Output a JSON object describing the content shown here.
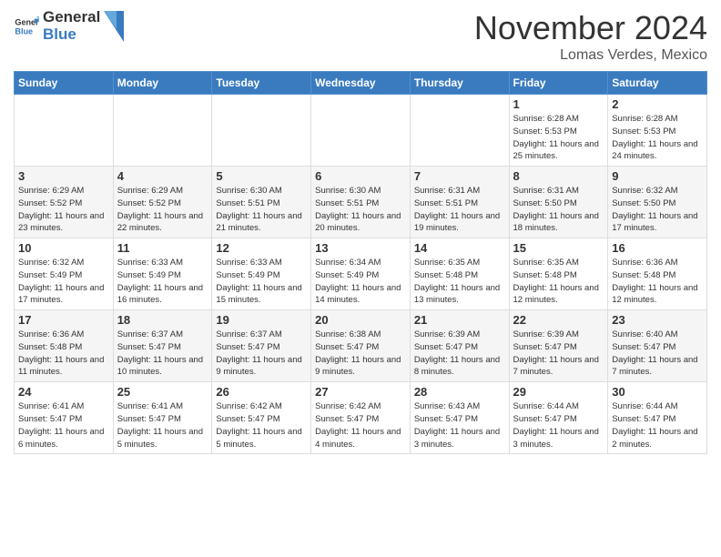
{
  "header": {
    "logo_general": "General",
    "logo_blue": "Blue",
    "month_title": "November 2024",
    "location": "Lomas Verdes, Mexico"
  },
  "weekdays": [
    "Sunday",
    "Monday",
    "Tuesday",
    "Wednesday",
    "Thursday",
    "Friday",
    "Saturday"
  ],
  "weeks": [
    [
      {
        "day": "",
        "detail": ""
      },
      {
        "day": "",
        "detail": ""
      },
      {
        "day": "",
        "detail": ""
      },
      {
        "day": "",
        "detail": ""
      },
      {
        "day": "",
        "detail": ""
      },
      {
        "day": "1",
        "detail": "Sunrise: 6:28 AM\nSunset: 5:53 PM\nDaylight: 11 hours\nand 25 minutes."
      },
      {
        "day": "2",
        "detail": "Sunrise: 6:28 AM\nSunset: 5:53 PM\nDaylight: 11 hours\nand 24 minutes."
      }
    ],
    [
      {
        "day": "3",
        "detail": "Sunrise: 6:29 AM\nSunset: 5:52 PM\nDaylight: 11 hours\nand 23 minutes."
      },
      {
        "day": "4",
        "detail": "Sunrise: 6:29 AM\nSunset: 5:52 PM\nDaylight: 11 hours\nand 22 minutes."
      },
      {
        "day": "5",
        "detail": "Sunrise: 6:30 AM\nSunset: 5:51 PM\nDaylight: 11 hours\nand 21 minutes."
      },
      {
        "day": "6",
        "detail": "Sunrise: 6:30 AM\nSunset: 5:51 PM\nDaylight: 11 hours\nand 20 minutes."
      },
      {
        "day": "7",
        "detail": "Sunrise: 6:31 AM\nSunset: 5:51 PM\nDaylight: 11 hours\nand 19 minutes."
      },
      {
        "day": "8",
        "detail": "Sunrise: 6:31 AM\nSunset: 5:50 PM\nDaylight: 11 hours\nand 18 minutes."
      },
      {
        "day": "9",
        "detail": "Sunrise: 6:32 AM\nSunset: 5:50 PM\nDaylight: 11 hours\nand 17 minutes."
      }
    ],
    [
      {
        "day": "10",
        "detail": "Sunrise: 6:32 AM\nSunset: 5:49 PM\nDaylight: 11 hours\nand 17 minutes."
      },
      {
        "day": "11",
        "detail": "Sunrise: 6:33 AM\nSunset: 5:49 PM\nDaylight: 11 hours\nand 16 minutes."
      },
      {
        "day": "12",
        "detail": "Sunrise: 6:33 AM\nSunset: 5:49 PM\nDaylight: 11 hours\nand 15 minutes."
      },
      {
        "day": "13",
        "detail": "Sunrise: 6:34 AM\nSunset: 5:49 PM\nDaylight: 11 hours\nand 14 minutes."
      },
      {
        "day": "14",
        "detail": "Sunrise: 6:35 AM\nSunset: 5:48 PM\nDaylight: 11 hours\nand 13 minutes."
      },
      {
        "day": "15",
        "detail": "Sunrise: 6:35 AM\nSunset: 5:48 PM\nDaylight: 11 hours\nand 12 minutes."
      },
      {
        "day": "16",
        "detail": "Sunrise: 6:36 AM\nSunset: 5:48 PM\nDaylight: 11 hours\nand 12 minutes."
      }
    ],
    [
      {
        "day": "17",
        "detail": "Sunrise: 6:36 AM\nSunset: 5:48 PM\nDaylight: 11 hours\nand 11 minutes."
      },
      {
        "day": "18",
        "detail": "Sunrise: 6:37 AM\nSunset: 5:47 PM\nDaylight: 11 hours\nand 10 minutes."
      },
      {
        "day": "19",
        "detail": "Sunrise: 6:37 AM\nSunset: 5:47 PM\nDaylight: 11 hours\nand 9 minutes."
      },
      {
        "day": "20",
        "detail": "Sunrise: 6:38 AM\nSunset: 5:47 PM\nDaylight: 11 hours\nand 9 minutes."
      },
      {
        "day": "21",
        "detail": "Sunrise: 6:39 AM\nSunset: 5:47 PM\nDaylight: 11 hours\nand 8 minutes."
      },
      {
        "day": "22",
        "detail": "Sunrise: 6:39 AM\nSunset: 5:47 PM\nDaylight: 11 hours\nand 7 minutes."
      },
      {
        "day": "23",
        "detail": "Sunrise: 6:40 AM\nSunset: 5:47 PM\nDaylight: 11 hours\nand 7 minutes."
      }
    ],
    [
      {
        "day": "24",
        "detail": "Sunrise: 6:41 AM\nSunset: 5:47 PM\nDaylight: 11 hours\nand 6 minutes."
      },
      {
        "day": "25",
        "detail": "Sunrise: 6:41 AM\nSunset: 5:47 PM\nDaylight: 11 hours\nand 5 minutes."
      },
      {
        "day": "26",
        "detail": "Sunrise: 6:42 AM\nSunset: 5:47 PM\nDaylight: 11 hours\nand 5 minutes."
      },
      {
        "day": "27",
        "detail": "Sunrise: 6:42 AM\nSunset: 5:47 PM\nDaylight: 11 hours\nand 4 minutes."
      },
      {
        "day": "28",
        "detail": "Sunrise: 6:43 AM\nSunset: 5:47 PM\nDaylight: 11 hours\nand 3 minutes."
      },
      {
        "day": "29",
        "detail": "Sunrise: 6:44 AM\nSunset: 5:47 PM\nDaylight: 11 hours\nand 3 minutes."
      },
      {
        "day": "30",
        "detail": "Sunrise: 6:44 AM\nSunset: 5:47 PM\nDaylight: 11 hours\nand 2 minutes."
      }
    ]
  ]
}
